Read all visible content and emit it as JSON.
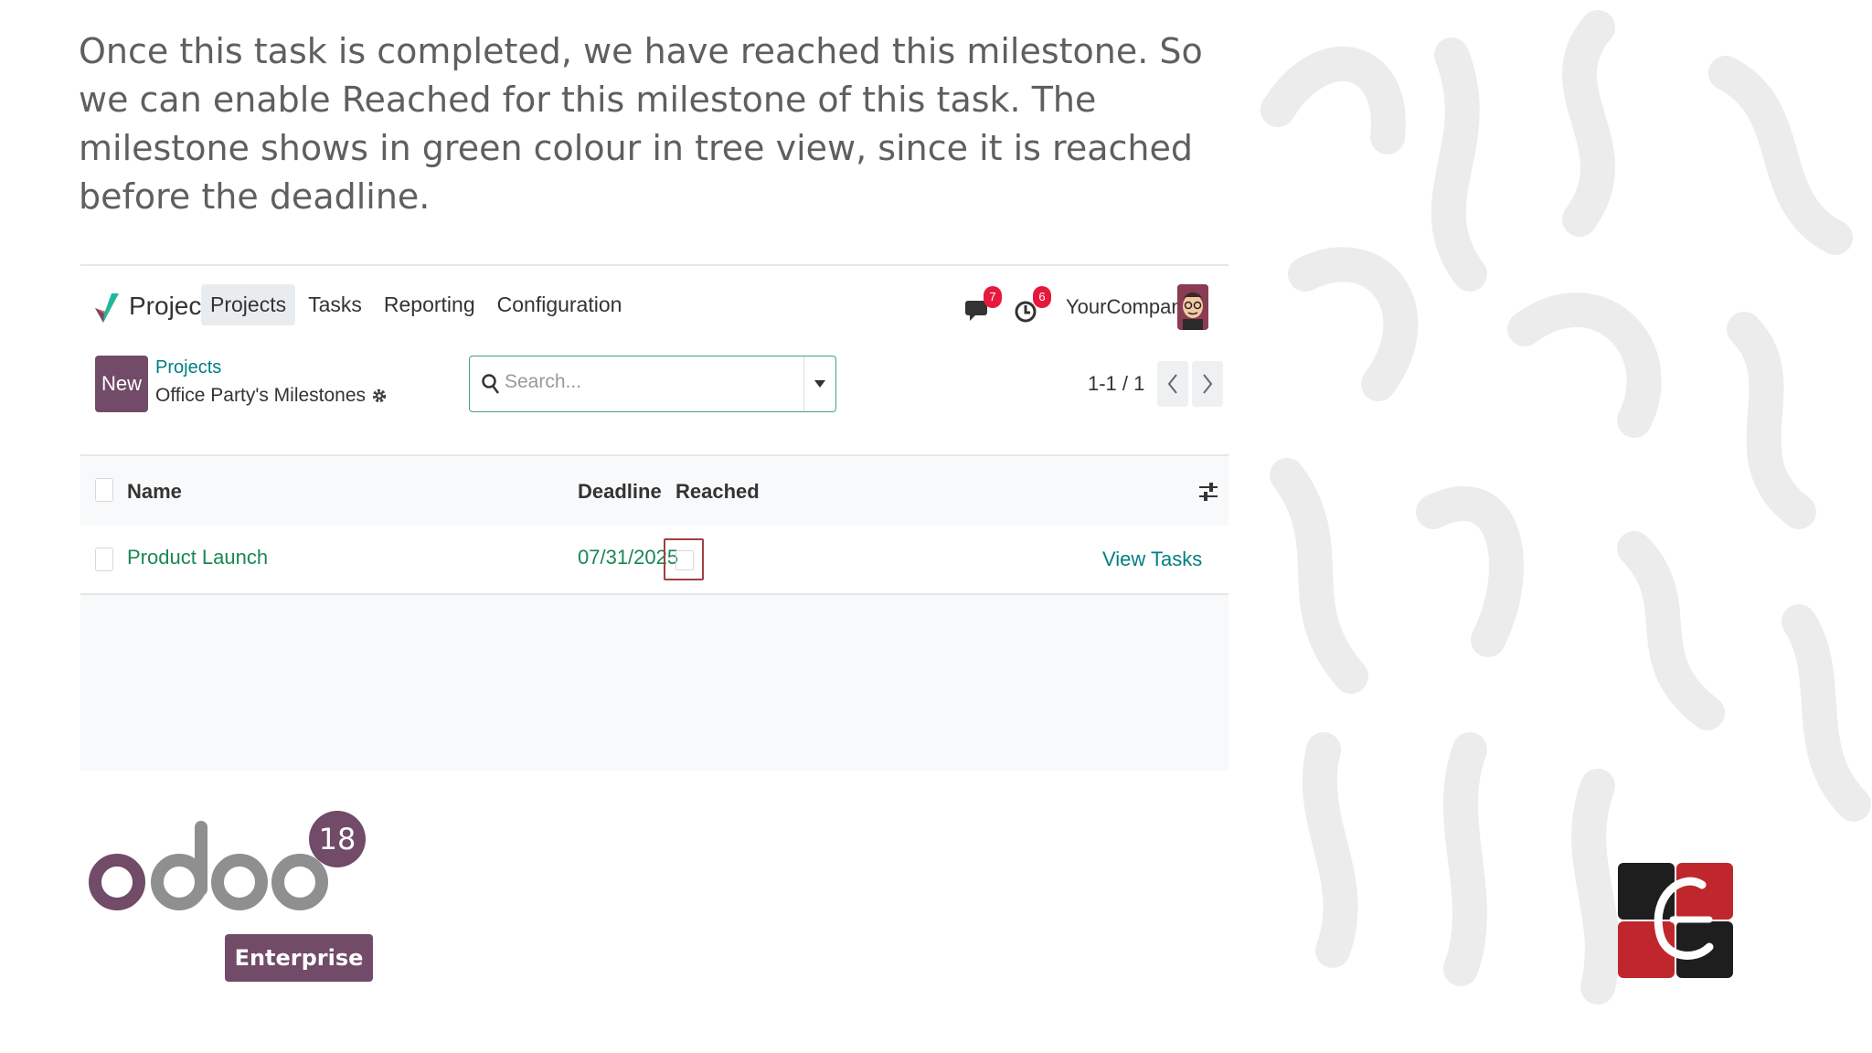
{
  "caption": "Once this task is completed, we have reached this milestone. So we can enable Reached for this milestone of this task. The milestone shows in green colour in tree view, since it is reached before the deadline.",
  "app": {
    "brand": "Project",
    "menu": [
      "Projects",
      "Tasks",
      "Reporting",
      "Configuration"
    ],
    "active_menu": "Projects",
    "messages_badge": "7",
    "activities_badge": "6",
    "company": "YourCompany"
  },
  "control": {
    "new_label": "New",
    "breadcrumb_parent": "Projects",
    "breadcrumb_current": "Office Party's Milestones",
    "search_placeholder": "Search...",
    "pager": "1-1 / 1"
  },
  "table": {
    "columns": [
      "Name",
      "Deadline",
      "Reached"
    ],
    "rows": [
      {
        "name": "Product Launch",
        "deadline": "07/31/2025",
        "reached": false,
        "action": "View Tasks"
      }
    ]
  },
  "branding": {
    "odoo_version": "18",
    "edition": "Enterprise"
  },
  "colors": {
    "primary": "#714b67",
    "reached_green": "#198754",
    "link_teal": "#017e84",
    "badge_red": "#e6193d",
    "highlight_border": "#9d4141"
  }
}
